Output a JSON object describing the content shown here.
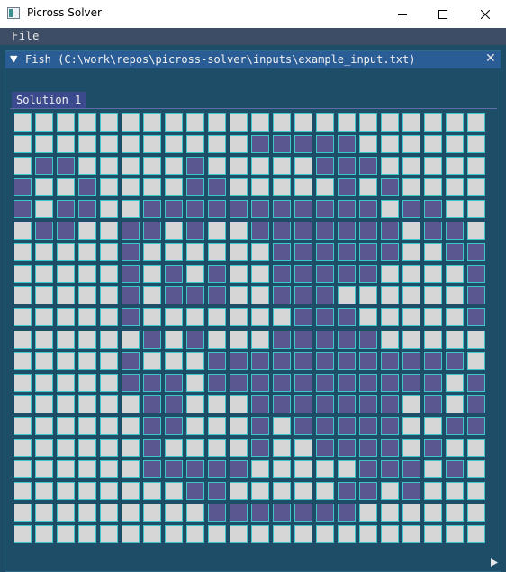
{
  "window": {
    "title": "Picross Solver",
    "minimize_icon": "minimize-icon",
    "maximize_icon": "maximize-icon",
    "close_icon": "close-icon"
  },
  "menu": {
    "file_label": "File"
  },
  "panel": {
    "collapse_icon": "▼",
    "title": "Fish (C:\\work\\repos\\picross-solver\\inputs\\example_input.txt)",
    "close_icon": "✕"
  },
  "tab": {
    "label": "Solution 1"
  },
  "colors": {
    "filled": "#5a5690",
    "empty": "#d6d6d6",
    "grid_line": "#3ec6cc",
    "panel_bg": "#1e4d68",
    "header_bg": "#2a5c96",
    "menu_bg": "#3e4d66"
  },
  "solution_grid": [
    "......................",
    "...........xxxxx......",
    ".xx.....x.....xxx.....",
    "x..x....xx.....x.x....",
    "x.xx..xxxxxxxxxxx.xx..",
    ".xx..xx.x..xxxxxxx.xx.",
    ".....x......xxxxxx..xx",
    ".....x.x.x..xxxxx....x",
    ".....x.xxx..xxx......x",
    ".....x.......xxx.....x",
    "......x.x...xxxxx.....",
    ".....x...xxxxxxxxxxxx.",
    ".....xxx.xxxxxxxxxxx.x",
    "......xx...xxxxxxx.x.x",
    "......xx...x.xxxxx..xx",
    "......x....x..xxxx.x..",
    "......xxxxx.....xxx.x.",
    "........xx.....xx.x...",
    ".........xxxxxxx......",
    "......................"
  ]
}
